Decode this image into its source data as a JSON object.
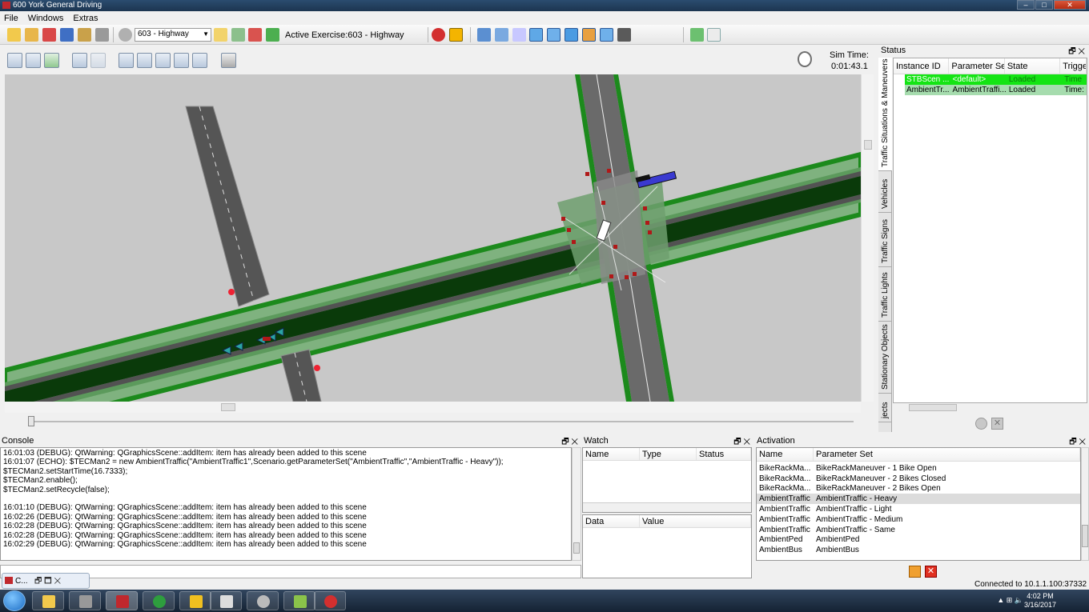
{
  "window": {
    "title": "600 York General Driving"
  },
  "menu": [
    "File",
    "Windows",
    "Extras"
  ],
  "toolbar": {
    "exercise_select": "603 - Highway",
    "active_exercise": "Active Exercise:603 - Highway"
  },
  "map": {
    "sim_time_label": "Sim Time:",
    "sim_time_value": "0:01:43.1",
    "colors": {
      "background": "#c8c8c8",
      "grass": "#7fb27f",
      "road": "#555555",
      "median": "#0a3a0a",
      "curb": "#1c8a1c"
    }
  },
  "status": {
    "title": "Status",
    "columns": [
      "Instance ID",
      "Parameter Set",
      "State",
      "Trigge"
    ],
    "rows": [
      {
        "id": "STBScen ...",
        "param": "<default>",
        "state": "Loaded",
        "trigger": "Time"
      },
      {
        "id": "AmbientTr...",
        "param": "AmbientTraffi...",
        "state": "Loaded",
        "trigger": "Time:"
      }
    ],
    "side_tabs": [
      "Traffic Situations & Maneuvers",
      "Vehicles",
      "Traffic Signs",
      "Traffic Lights",
      "Stationary Objects",
      "jects"
    ]
  },
  "console": {
    "title": "Console",
    "lines": [
      "16:01:03 (DEBUG): QtWarning: QGraphicsScene::addItem: item has already been added to this scene",
      "16:01:07 (ECHO): $TECMan2 = new AmbientTraffic(\"AmbientTraffic1\",Scenario.getParameterSet(\"AmbientTraffic\",\"AmbientTraffic - Heavy\"));",
      "$TECMan2.setStartTime(16.7333);",
      "$TECMan2.enable();",
      "$TECMan2.setRecycle(false);",
      "",
      "16:01:10 (DEBUG): QtWarning: QGraphicsScene::addItem: item has already been added to this scene",
      "16:02:26 (DEBUG): QtWarning: QGraphicsScene::addItem: item has already been added to this scene",
      "16:02:28 (DEBUG): QtWarning: QGraphicsScene::addItem: item has already been added to this scene",
      "16:02:28 (DEBUG): QtWarning: QGraphicsScene::addItem: item has already been added to this scene",
      "16:02:29 (DEBUG): QtWarning: QGraphicsScene::addItem: item has already been added to this scene"
    ]
  },
  "watch": {
    "title": "Watch",
    "columns": [
      "Name",
      "Type",
      "Status"
    ],
    "value_columns": [
      "Data",
      "Value"
    ]
  },
  "activation": {
    "title": "Activation",
    "columns": [
      "Name",
      "Parameter Set"
    ],
    "rows": [
      {
        "name": "BikeRackMa...",
        "param": "BikeRackManeuver - 1 Bike Open"
      },
      {
        "name": "BikeRackMa...",
        "param": "BikeRackManeuver - 2 Bikes Closed"
      },
      {
        "name": "BikeRackMa...",
        "param": "BikeRackManeuver - 2 Bikes Open"
      },
      {
        "name": "AmbientTraffic",
        "param": "AmbientTraffic - Heavy"
      },
      {
        "name": "AmbientTraffic",
        "param": "AmbientTraffic - Light"
      },
      {
        "name": "AmbientTraffic",
        "param": "AmbientTraffic - Medium"
      },
      {
        "name": "AmbientTraffic",
        "param": "AmbientTraffic - Same"
      },
      {
        "name": "AmbientPed",
        "param": "AmbientPed"
      },
      {
        "name": "AmbientBus",
        "param": "AmbientBus"
      }
    ],
    "selected_index": 3
  },
  "connection": "Connected to 10.1.1.100:37332",
  "minimized": {
    "label": "C..."
  },
  "taskbar": {
    "time": "4:02 PM",
    "date": "3/16/2017"
  }
}
